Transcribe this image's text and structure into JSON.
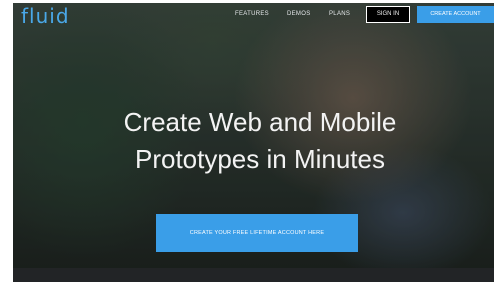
{
  "header": {
    "logo": "fluid",
    "nav": {
      "features": "FEATURES",
      "demos": "DEMOS",
      "plans": "PLANS"
    },
    "signin_label": "SIGN IN",
    "create_account_label": "CREATE ACCOUNT"
  },
  "hero": {
    "headline_line1": "Create Web and Mobile",
    "headline_line2": "Prototypes in Minutes",
    "cta_label": "CREATE YOUR FREE LIFETIME ACCOUNT HERE"
  },
  "colors": {
    "accent": "#3a9ee8",
    "logo": "#4aa8e8",
    "bottom_bar": "#222426"
  }
}
